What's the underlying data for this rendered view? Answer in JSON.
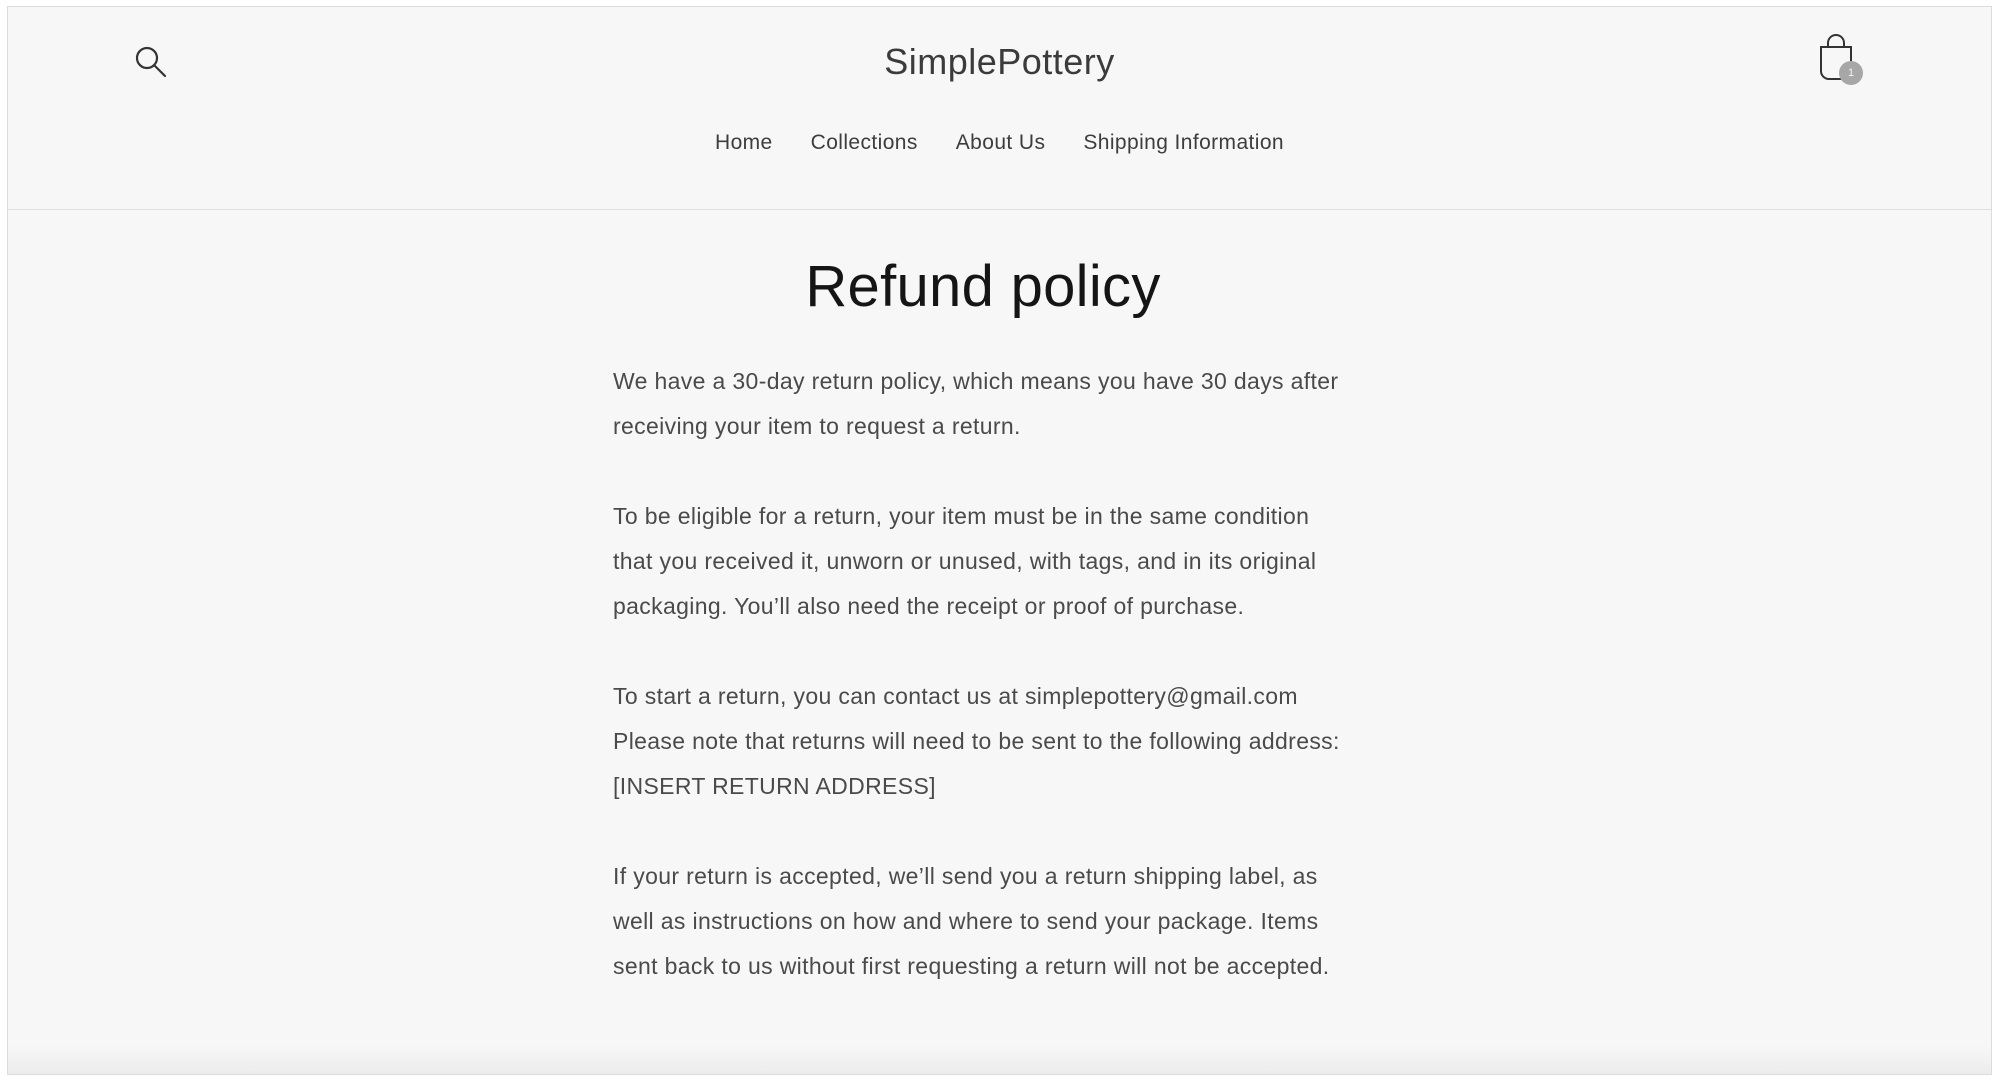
{
  "header": {
    "logo": "SimplePottery",
    "cart_count": "1",
    "icons": {
      "search": "search-icon",
      "cart": "shopping-bag-icon"
    }
  },
  "nav": {
    "items": [
      {
        "label": "Home"
      },
      {
        "label": "Collections"
      },
      {
        "label": "About Us"
      },
      {
        "label": "Shipping Information"
      }
    ]
  },
  "page": {
    "title": "Refund policy",
    "paragraphs": [
      "We have a 30-day return policy, which means you have 30 days after receiving your item to request a return.",
      "To be eligible for a return, your item must be in the same condition that you received it, unworn or unused, with tags, and in its original packaging. You’ll also need the receipt or proof of purchase.",
      "To start a return, you can contact us at simplepottery@gmail.com Please note that returns will need to be sent to the following address: [INSERT RETURN ADDRESS]",
      "If your return is accepted, we’ll send you a return shipping label, as well as instructions on how and where to send your package. Items sent back to us without first requesting a return will not be accepted."
    ]
  },
  "colors": {
    "background": "#f7f7f7",
    "text": "#4a4a4a",
    "title": "#151515",
    "badge": "#a7a7a7"
  }
}
